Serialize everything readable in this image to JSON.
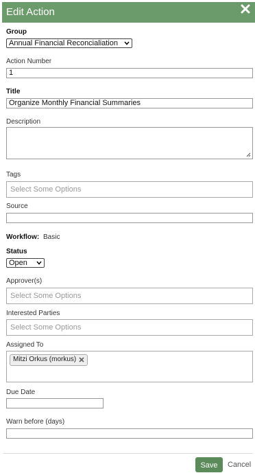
{
  "dialog": {
    "title": "Edit Action"
  },
  "form": {
    "group": {
      "label": "Group",
      "value": "Annual Financial Reconcialiation"
    },
    "action_number": {
      "label": "Action Number",
      "value": "1"
    },
    "title": {
      "label": "Title",
      "value": "Organize Monthly Financial Summaries"
    },
    "description": {
      "label": "Description",
      "value": ""
    },
    "tags": {
      "label": "Tags",
      "placeholder": "Select Some Options"
    },
    "source": {
      "label": "Source",
      "value": ""
    },
    "workflow": {
      "label": "Workflow:",
      "value": "Basic"
    },
    "status": {
      "label": "Status",
      "value": "Open"
    },
    "approvers": {
      "label": "Approver(s)",
      "placeholder": "Select Some Options"
    },
    "interested_parties": {
      "label": "Interested Parties",
      "placeholder": "Select Some Options"
    },
    "assigned_to": {
      "label": "Assigned To",
      "chips": [
        "Mitzi Orkus (morkus)"
      ]
    },
    "due_date": {
      "label": "Due Date",
      "value": ""
    },
    "warn_before": {
      "label": "Warn before (days)",
      "value": ""
    }
  },
  "footer": {
    "save_label": "Save",
    "cancel_label": "Cancel"
  },
  "colors": {
    "header": "#6b9a6b",
    "save_button": "#5b8a5b"
  },
  "icons": {
    "close": "close-icon",
    "dropdown": "chevron-down-icon",
    "chip_remove": "remove-icon"
  }
}
